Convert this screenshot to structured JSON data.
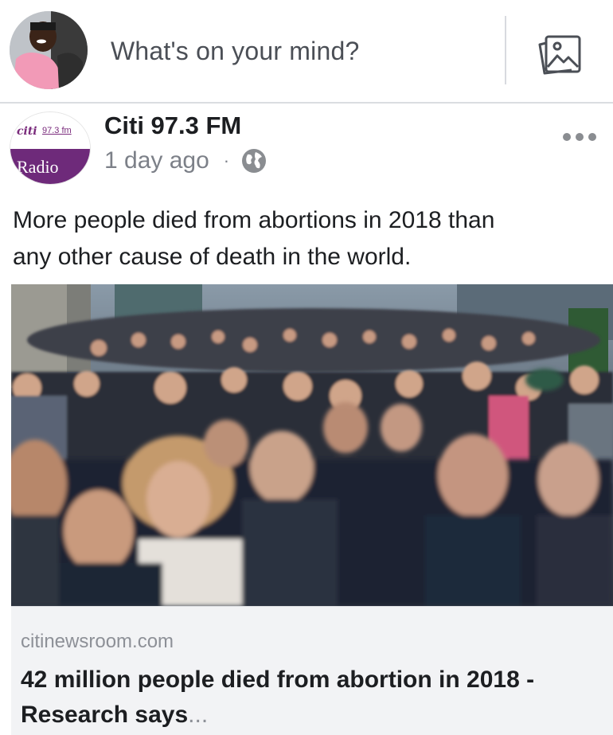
{
  "composer": {
    "prompt": "What's on your mind?",
    "photo_icon": "photo-icon"
  },
  "post": {
    "page_name": "Citi 97.3 FM",
    "logo": {
      "word": "citi",
      "frequency": "97.3 fm",
      "radio": "Radio"
    },
    "time": "1 day ago",
    "separator": "·",
    "privacy_icon": "globe-icon",
    "more_icon": "more-options-icon",
    "text_line1": "More people died from abortions in 2018 than",
    "text_line2": "any other cause of death in the world.",
    "image_alt": "crowd-photo",
    "link": {
      "domain": "citinewsroom.com",
      "title_line1": "42 million people died from abortion in 2018 -",
      "title_line2": "Research says",
      "ellipsis": "..."
    }
  },
  "colors": {
    "text": "#1c1e21",
    "secondary": "#7c8088",
    "logo_purple": "#6e2a7a",
    "preview_bg": "#f2f3f5"
  }
}
